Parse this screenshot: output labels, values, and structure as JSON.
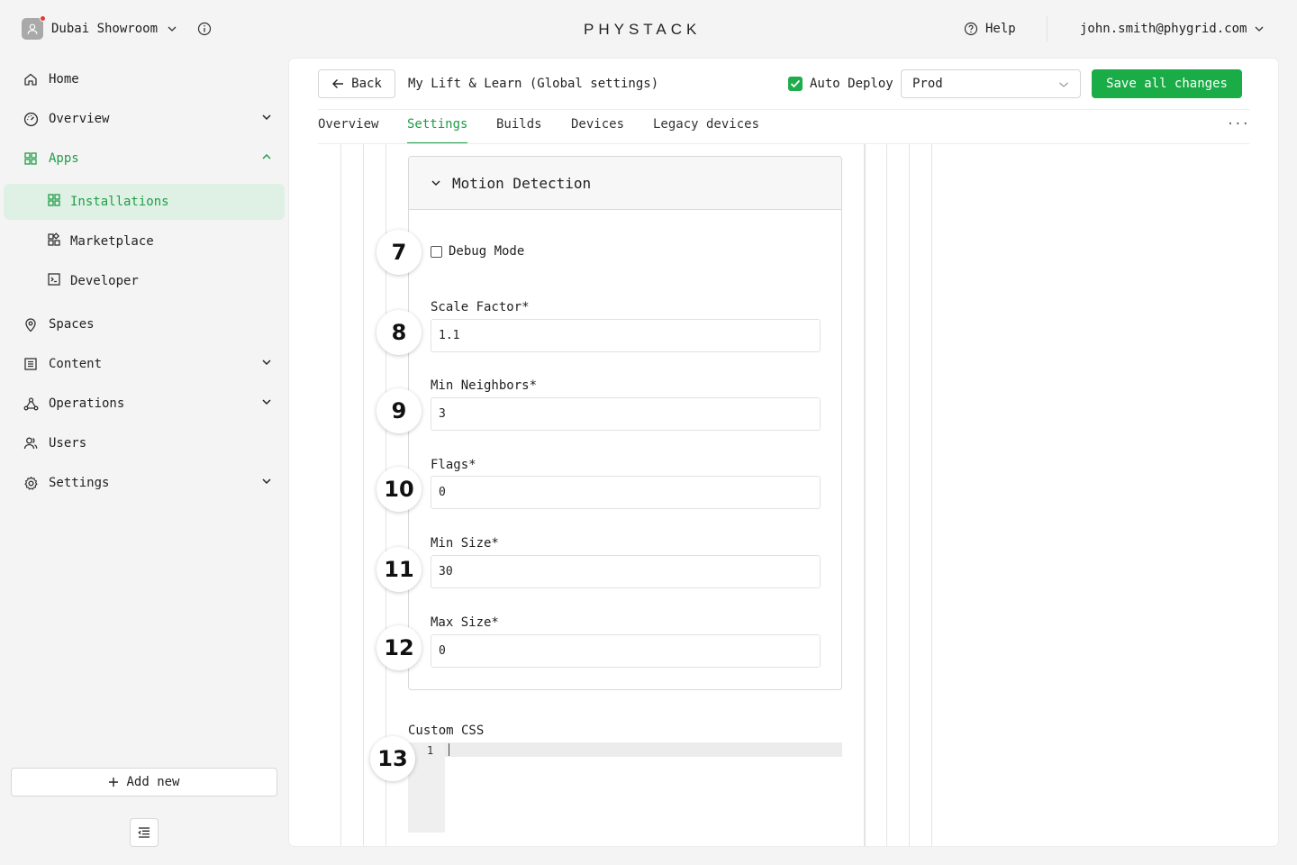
{
  "org": {
    "name": "Dubai Showroom"
  },
  "logo": "PHYSTACK",
  "help": {
    "label": "Help"
  },
  "user": {
    "email": "john.smith@phygrid.com"
  },
  "sidebar": {
    "items": [
      {
        "label": "Home",
        "icon": "home-icon"
      },
      {
        "label": "Overview",
        "icon": "gauge-icon"
      },
      {
        "label": "Apps",
        "icon": "apps-grid-icon"
      },
      {
        "label": "Installations",
        "icon": "apps-grid-icon"
      },
      {
        "label": "Marketplace",
        "icon": "marketplace-icon"
      },
      {
        "label": "Developer",
        "icon": "terminal-icon"
      },
      {
        "label": "Spaces",
        "icon": "location-pin-icon"
      },
      {
        "label": "Content",
        "icon": "content-list-icon"
      },
      {
        "label": "Operations",
        "icon": "operations-icon"
      },
      {
        "label": "Users",
        "icon": "users-icon"
      },
      {
        "label": "Settings",
        "icon": "gear-icon"
      }
    ],
    "add_new": "Add new"
  },
  "header": {
    "back": "Back",
    "title": "My Lift & Learn (Global settings)",
    "auto_deploy": "Auto Deploy",
    "env": "Prod",
    "save": "Save all changes"
  },
  "tabs": [
    "Overview",
    "Settings",
    "Builds",
    "Devices",
    "Legacy devices"
  ],
  "tabs_more": "···",
  "panel": {
    "title": "Motion Detection",
    "debug_label": "Debug Mode",
    "fields": [
      {
        "label": "Scale Factor*",
        "value": "1.1"
      },
      {
        "label": "Min Neighbors*",
        "value": "3"
      },
      {
        "label": "Flags*",
        "value": "0"
      },
      {
        "label": "Min Size*",
        "value": "30"
      },
      {
        "label": "Max Size*",
        "value": "0"
      }
    ]
  },
  "custom_css": {
    "label": "Custom CSS",
    "line": "1"
  },
  "badges": [
    "7",
    "8",
    "9",
    "10",
    "11",
    "12",
    "13"
  ],
  "colors": {
    "accent": "#1aac47",
    "accent_text": "#1f9d47",
    "active_bg": "#dff1e4"
  }
}
